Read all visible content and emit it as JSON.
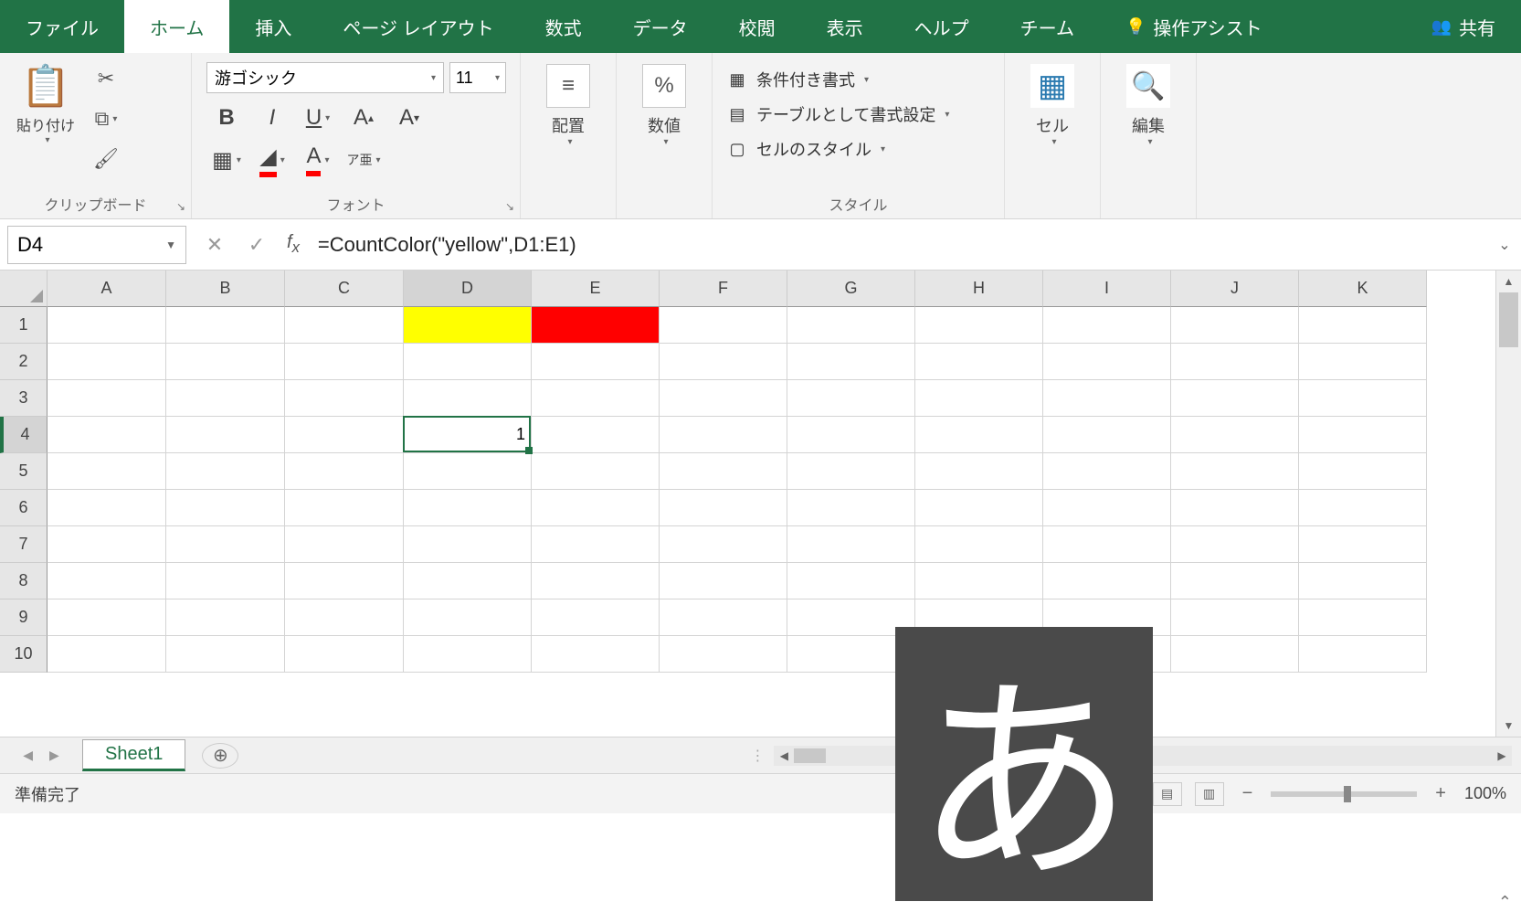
{
  "tabs": {
    "file": "ファイル",
    "home": "ホーム",
    "insert": "挿入",
    "page_layout": "ページ レイアウト",
    "formulas": "数式",
    "data": "データ",
    "review": "校閲",
    "view": "表示",
    "help": "ヘルプ",
    "team": "チーム",
    "tell_me": "操作アシスト",
    "share": "共有"
  },
  "ribbon": {
    "clipboard": {
      "label": "クリップボード",
      "paste": "貼り付け"
    },
    "font": {
      "label": "フォント",
      "name": "游ゴシック",
      "size": "11",
      "ruby": "ア亜"
    },
    "alignment": {
      "label": "配置"
    },
    "number": {
      "label": "数値"
    },
    "styles": {
      "label": "スタイル",
      "conditional": "条件付き書式",
      "table": "テーブルとして書式設定",
      "cell_styles": "セルのスタイル"
    },
    "cells": {
      "label": "セル"
    },
    "editing": {
      "label": "編集"
    }
  },
  "formula_bar": {
    "name_box": "D4",
    "formula": "=CountColor(\"yellow\",D1:E1)"
  },
  "grid": {
    "columns": [
      "A",
      "B",
      "C",
      "D",
      "E",
      "F",
      "G",
      "H",
      "I",
      "J",
      "K"
    ],
    "rows": [
      "1",
      "2",
      "3",
      "4",
      "5",
      "6",
      "7",
      "8",
      "9",
      "10"
    ],
    "selected_cell_value": "1",
    "d1_fill": "yellow",
    "e1_fill": "red"
  },
  "sheet_tabs": {
    "sheet1": "Sheet1"
  },
  "status": {
    "ready": "準備完了",
    "zoom": "100%"
  },
  "ime": {
    "char": "あ"
  }
}
